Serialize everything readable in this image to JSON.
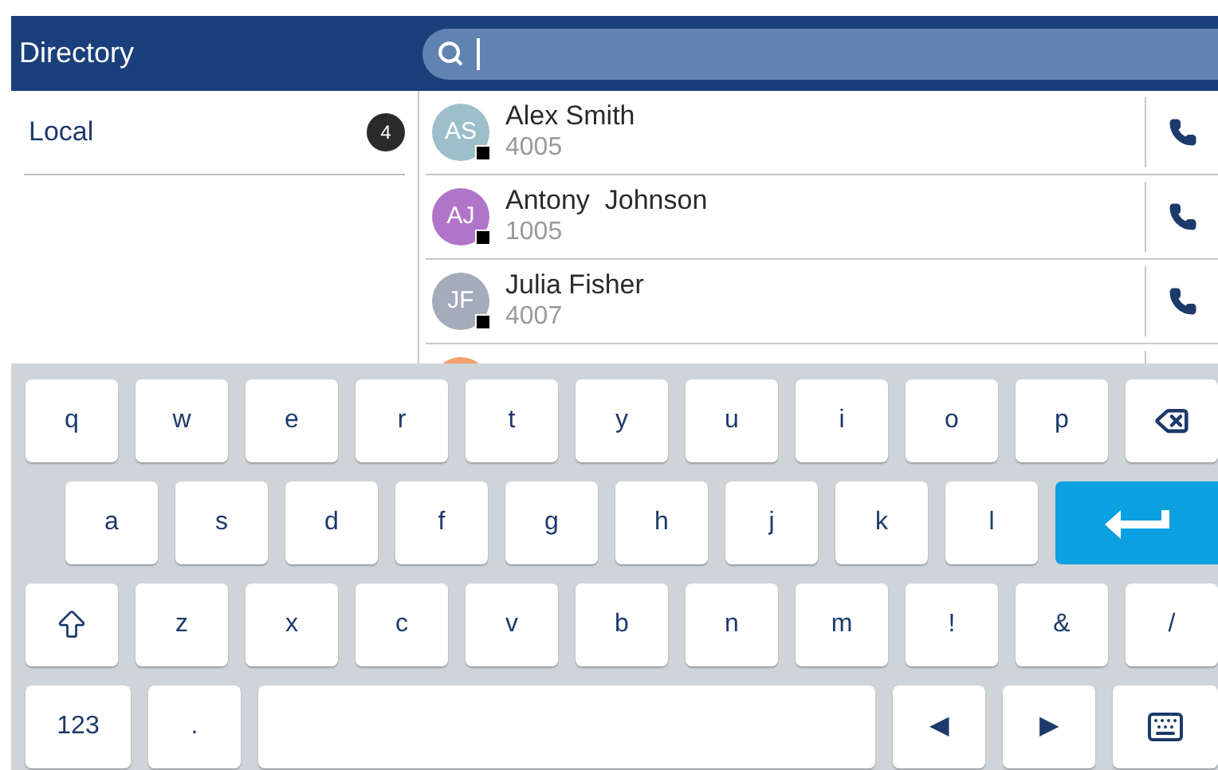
{
  "header": {
    "title": "Directory"
  },
  "search": {
    "focused": true
  },
  "sidebar": {
    "items": [
      {
        "label": "Local",
        "count": "4",
        "selected": true
      }
    ]
  },
  "contacts": [
    {
      "initials": "AS",
      "name": "Alex Smith",
      "number": "4005",
      "color": "#9dbfcc"
    },
    {
      "initials": "AJ",
      "name": "Antony  Johnson",
      "number": "1005",
      "color": "#b074c8"
    },
    {
      "initials": "JF",
      "name": "Julia Fisher",
      "number": "4007",
      "color": "#a4acbb"
    },
    {
      "color": "#f4a06a"
    }
  ],
  "keyboard": {
    "rows": [
      [
        {
          "kind": "char",
          "label": "q"
        },
        {
          "kind": "char",
          "label": "w"
        },
        {
          "kind": "char",
          "label": "e"
        },
        {
          "kind": "char",
          "label": "r"
        },
        {
          "kind": "char",
          "label": "t"
        },
        {
          "kind": "char",
          "label": "y"
        },
        {
          "kind": "char",
          "label": "u"
        },
        {
          "kind": "char",
          "label": "i"
        },
        {
          "kind": "char",
          "label": "o"
        },
        {
          "kind": "char",
          "label": "p"
        },
        {
          "kind": "backspace"
        }
      ],
      [
        {
          "kind": "char",
          "label": "a"
        },
        {
          "kind": "char",
          "label": "s"
        },
        {
          "kind": "char",
          "label": "d"
        },
        {
          "kind": "char",
          "label": "f"
        },
        {
          "kind": "char",
          "label": "g"
        },
        {
          "kind": "char",
          "label": "h"
        },
        {
          "kind": "char",
          "label": "j"
        },
        {
          "kind": "char",
          "label": "k"
        },
        {
          "kind": "char",
          "label": "l"
        },
        {
          "kind": "enter"
        }
      ],
      [
        {
          "kind": "shift"
        },
        {
          "kind": "char",
          "label": "z"
        },
        {
          "kind": "char",
          "label": "x"
        },
        {
          "kind": "char",
          "label": "c"
        },
        {
          "kind": "char",
          "label": "v"
        },
        {
          "kind": "char",
          "label": "b"
        },
        {
          "kind": "char",
          "label": "n"
        },
        {
          "kind": "char",
          "label": "m"
        },
        {
          "kind": "char",
          "label": "!"
        },
        {
          "kind": "char",
          "label": "&"
        },
        {
          "kind": "char",
          "label": "/"
        }
      ],
      [
        {
          "kind": "wide",
          "label": "123"
        },
        {
          "kind": "char",
          "label": "."
        },
        {
          "kind": "space"
        },
        {
          "kind": "char",
          "label": "◀"
        },
        {
          "kind": "char",
          "label": "▶"
        },
        {
          "kind": "hide"
        }
      ]
    ]
  }
}
